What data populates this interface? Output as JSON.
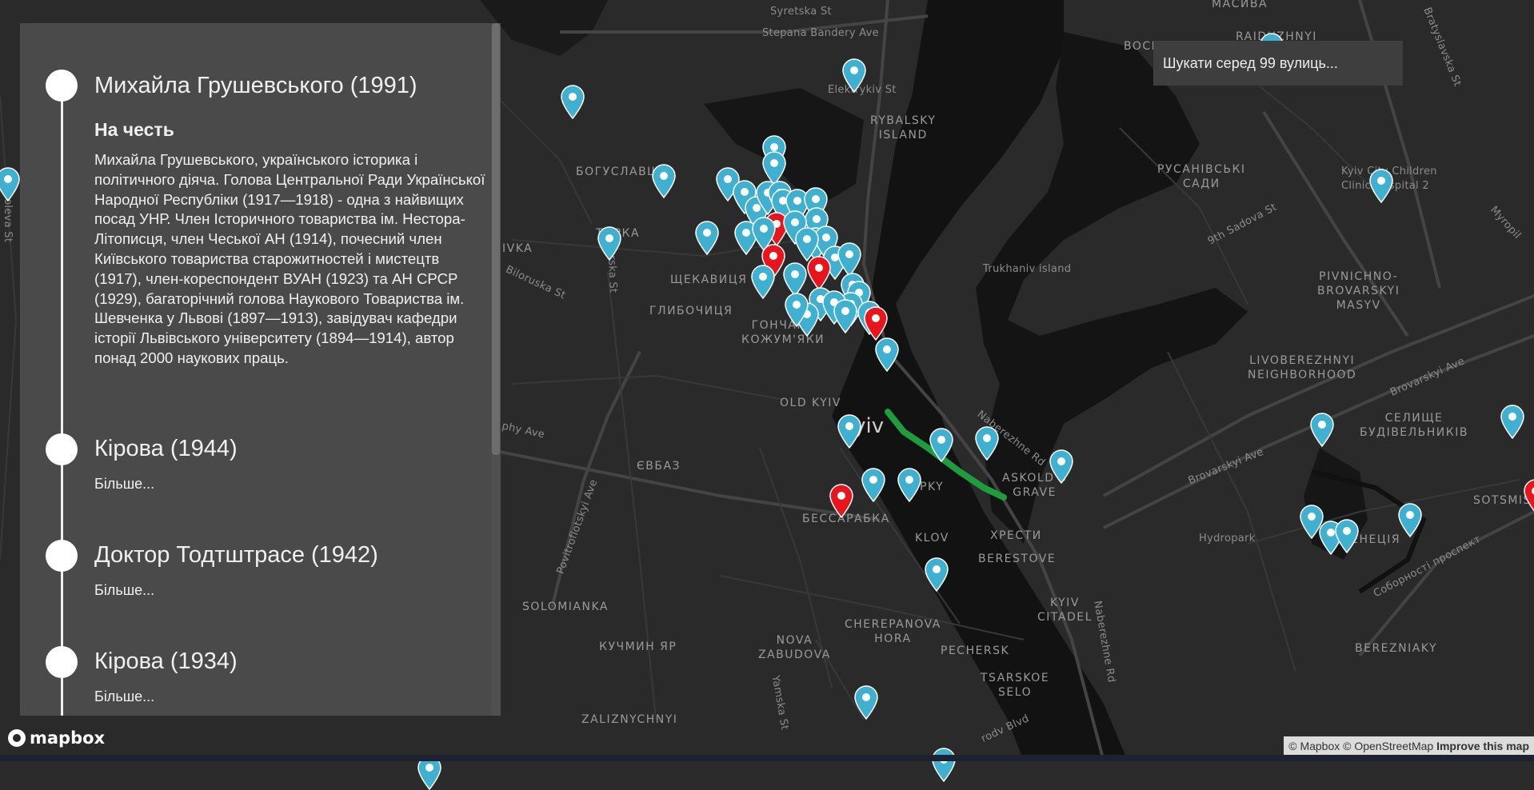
{
  "sidebar": {
    "entries": [
      {
        "title": "Михайла Грушевського (1991)",
        "honor_heading": "На честь",
        "honor_text": "Михайла Грушевського, українського історика і політичного діяча. Голова Центральної Ради Української Народної Республіки (1917—1918) - одна з найвищих посад УНР. Член Історичного товариства ім. Нестора-Літописця, член Чеської АН (1914), почесний член Київського товариства старожитностей і мистецтв (1917), член-кореспондент ВУАН (1923) та АН СРСР (1929), багаторічний голова Наукового Товариства ім. Шевченка у Львові (1897—1913), завідувач кафедри історії Львівського університету (1894—1914), автор понад 2000 наукових праць."
      },
      {
        "title": "Кірова (1944)",
        "more": "Більше..."
      },
      {
        "title": "Доктор Тодтштрасе (1942)",
        "more": "Більше..."
      },
      {
        "title": "Кірова (1934)",
        "more": "Більше..."
      }
    ]
  },
  "search": {
    "placeholder": "Шукати серед 99 вулиць..."
  },
  "map": {
    "labels": {
      "syretska": "Syretska St",
      "stepana_bandery": "Stepana Bandery Ave",
      "elektrykiv": "Elektrykiv St",
      "rybalsky": "RYBALSKY\nISLAND",
      "bohuslavshchyna": "БОГУСЛАВЩ",
      "torka": "ТОРКА",
      "shchekavytsia": "ЩЕКАВИЦЯ",
      "hlybochytsia": "ГЛИБОЧИЦЯ",
      "honchari": "ГОНЧАРІ-\nКОЖУМ'ЯКИ",
      "old_kyiv": "OLD KYIV",
      "kyiv": "Kyiv",
      "yevbaz": "ЄВБАЗ",
      "bessarabka": "БЕССАРАБКА",
      "klov": "KLOV",
      "khresty": "ХРЕСТИ",
      "berestove": "BERESTOVE",
      "askold": "ASKOLD'S\nGRAVE",
      "naberezhne": "Naberezhne Rd",
      "naberezhne2": "Naberezhne Rd",
      "solomianka": "SOLOMIANKA",
      "kuchmyn_yar": "КУЧМИН ЯР",
      "nova_zabudova": "NOVA\nZABUDOVA",
      "cherepanova": "CHEREPANOVA\nHORA",
      "pechersk": "PECHERSK",
      "kyiv_citadel": "KYIV\nCITADEL",
      "tsarskoe": "TSARSKOE\nSELO",
      "zaliznychnyi": "ZALIZNYCHNYI",
      "trukhaniv": "Trukhaniv island",
      "rusanivski": "РУСАНІВСЬКІ\nСАДИ",
      "livoberezhnyi": "LIVOBEREZHNYI\nNEIGHBORHOOD",
      "pivnichno": "PIVNICHNO-\nBROVARSKYI\nMASYV",
      "brovarskyi_ave": "Brovarskyi Ave",
      "selyshche": "СЕЛИЩЕ\nБУДІВЕЛЬНИКІВ",
      "hydropark": "Hydropark",
      "venetsia": "ВЕНЕЦІЯ",
      "berezniaky": "BEREZNIAKY",
      "sotsmisto": "SOTSMIS",
      "sobornosti": "Соборності проспект",
      "children_clinic": "Kyiv City Children\nClinic Hospital 2",
      "sadova": "9th Sadova St",
      "myropil": "Myropil",
      "bratyslavska": "Bratyslavska St",
      "boch": "BOCH",
      "raiduzhnyi": "RAIDUZHNYI",
      "masyva": "МАСИВА",
      "biloruska": "Biloruska St",
      "povitroflotskyi": "Povitroflotskyi Ave",
      "yamska": "Yamska St",
      "chorno": "phy Ave",
      "tupoleva": "Tupoleva St",
      "ivka": "IVKA",
      "narska": "Tatarska St",
      "pkv": "PKY",
      "lesi": "rodv Blvd"
    },
    "markers_note": "blue markers and red markers",
    "colors": {
      "marker_blue": "#3fb0d0",
      "marker_red": "#e8151c",
      "route_green": "#1f9d3e",
      "water": "#111111"
    }
  },
  "footer": {
    "mapbox_logo": "mapbox",
    "attribution_mapbox": "© Mapbox",
    "attribution_osm": "© OpenStreetMap",
    "improve": "Improve this map"
  }
}
